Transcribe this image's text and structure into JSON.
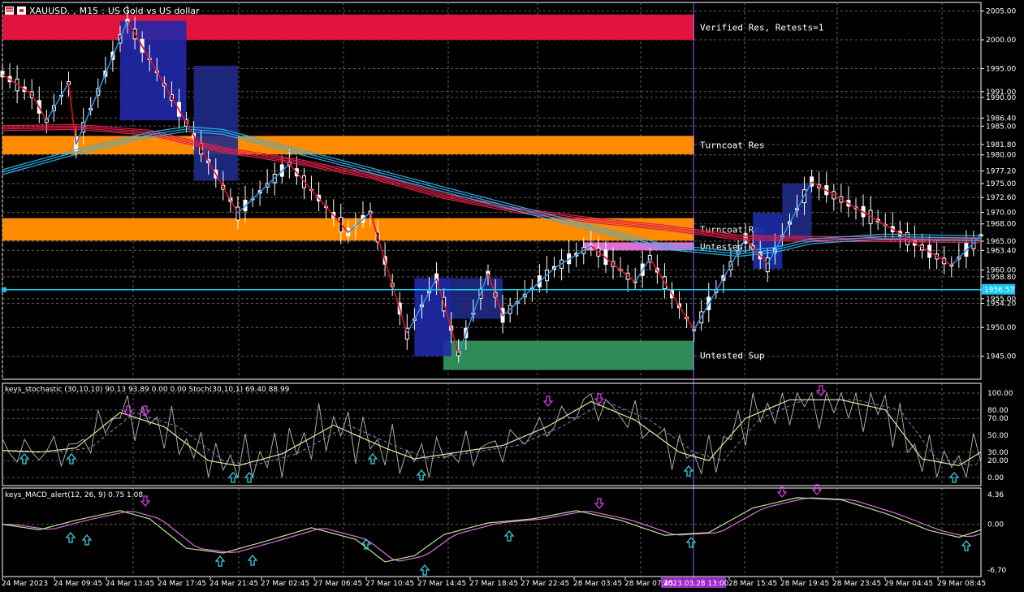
{
  "window": {
    "symbol": "XAUUSD.",
    "timeframe": "M15",
    "description": "US Gold vs US dollar"
  },
  "colors": {
    "bg": "#000000",
    "bull": "#ffffff",
    "bear": "#ffffff",
    "zigzag_up": "#2f8fe0",
    "zigzag_down": "#e01020",
    "verified_res": "#e0143c",
    "turncoat": "#ff8c00",
    "untested_sup": "#2e8b57",
    "untested_res": "#e070d0",
    "hline": "#19c8f0",
    "ma_red": "#e0204a",
    "ma_blue": "#2fb0e8",
    "grid": "#606060",
    "stoch_k": "#a8a8a8",
    "stoch_d": "#b070c0",
    "stoch_sig": "#d0f0a0",
    "macd": "#b8e890",
    "macd_sig": "#e070e0",
    "arrow_up": "#3ad0e0",
    "arrow_down": "#d040e0",
    "cursor": "#9966ff"
  },
  "main": {
    "price_axis": [
      "2005.00",
      "2000.00",
      "1995.00",
      "1991.00",
      "1990.00",
      "1986.40",
      "1985.00",
      "1981.80",
      "1980.00",
      "1977.20",
      "1975.00",
      "1972.60",
      "1970.00",
      "1968.00",
      "1965.00",
      "1963.40",
      "1960.00",
      "1958.80",
      "1956.57",
      "1955.00",
      "1954.20",
      "1950.00",
      "1945.00"
    ],
    "current_price": "1956.57",
    "zones": [
      {
        "label": "Verified Res, Retests=1",
        "kind": "verified_res",
        "low": 2000.0,
        "high": 2004.4
      },
      {
        "label": "Turncoat Res",
        "kind": "turncoat",
        "low": 1980.1,
        "high": 1983.3
      },
      {
        "label": "Turncoat Res",
        "kind": "turncoat",
        "low": 1965.1,
        "high": 1969.0
      },
      {
        "label": "Untested Res",
        "kind": "untested_res",
        "low": 1963.4,
        "high": 1964.8
      },
      {
        "label": "Untested Sup",
        "kind": "untested_sup",
        "low": 1942.6,
        "high": 1947.7
      }
    ]
  },
  "stoch": {
    "title": "keys_stochastic (30,10,10) 90.13 93.89 0.00 0.00 Stoch(30,10,1) 69.40 88.99",
    "axis": [
      "100.00",
      "80.00",
      "70.00",
      "50.00",
      "30.00",
      "20.00",
      "0.00"
    ]
  },
  "macd": {
    "title": "keys_MACD_alert(12, 26, 9) 0.75 1.08",
    "axis": [
      "4.36",
      "0.00",
      "-6.70"
    ]
  },
  "time_axis": [
    "24 Mar 2023",
    "24 Mar 09:45",
    "24 Mar 13:45",
    "24 Mar 17:45",
    "24 Mar 21:45",
    "27 Mar 02:45",
    "27 Mar 06:45",
    "27 Mar 10:45",
    "27 Mar 14:45",
    "27 Mar 18:45",
    "27 Mar 22:45",
    "28 Mar 03:45",
    "28 Mar 07:45",
    "28 Mar 15:45",
    "28 Mar 19:45",
    "28 Mar 23:45",
    "29 Mar 04:45",
    "29 Mar 08:45"
  ],
  "cursor_time": "2023.03.28 13:00",
  "chart_data": {
    "type": "line",
    "title": "XAUUSD., M15: US Gold vs US dollar",
    "y_range": [
      1941.0,
      2006.5
    ],
    "zigzag": [
      [
        0,
        1994.0
      ],
      [
        4,
        1990.5
      ],
      [
        6,
        1986.0
      ],
      [
        9,
        1992.5
      ],
      [
        10,
        1981.8
      ],
      [
        17,
        2003.3
      ],
      [
        25,
        1985.6
      ],
      [
        32,
        1969.9
      ],
      [
        39,
        1978.4
      ],
      [
        47,
        1966.5
      ],
      [
        50,
        1970.0
      ],
      [
        55,
        1949.0
      ],
      [
        59,
        1958.5
      ],
      [
        62,
        1945.5
      ],
      [
        66,
        1959.4
      ],
      [
        68,
        1952.0
      ],
      [
        75,
        1960.3
      ],
      [
        80,
        1964.2
      ],
      [
        86,
        1957.9
      ],
      [
        88,
        1962.0
      ],
      [
        94,
        1949.6
      ],
      [
        99,
        1960.8
      ],
      [
        101,
        1965.4
      ],
      [
        104,
        1961.0
      ],
      [
        110,
        1975.3
      ],
      [
        122,
        1966.3
      ],
      [
        129,
        1960.8
      ],
      [
        133,
        1966.0
      ]
    ],
    "key_candles": [
      [
        0,
        1992.0,
        1994.5,
        1990.0,
        1991.5
      ],
      [
        10,
        1986.0,
        1987.0,
        1981.8,
        1982.5
      ],
      [
        17,
        1999.0,
        2003.3,
        1998.0,
        2002.0
      ],
      [
        25,
        1986.0,
        1987.5,
        1983.5,
        1985.6
      ],
      [
        32,
        1971.0,
        1972.0,
        1969.9,
        1970.5
      ],
      [
        55,
        1950.5,
        1952.0,
        1949.0,
        1950.0
      ],
      [
        62,
        1946.0,
        1949.0,
        1945.5,
        1948.0
      ],
      [
        94,
        1950.0,
        1951.0,
        1949.6,
        1950.5
      ],
      [
        110,
        1974.0,
        1975.3,
        1972.5,
        1975.0
      ],
      [
        129,
        1961.5,
        1962.0,
        1960.8,
        1961.0
      ],
      [
        133,
        1964.5,
        1966.0,
        1963.5,
        1965.5
      ]
    ],
    "ma_red": [
      [
        0,
        1984.8
      ],
      [
        10,
        1985.0
      ],
      [
        20,
        1984.0
      ],
      [
        30,
        1981.0
      ],
      [
        40,
        1979.0
      ],
      [
        50,
        1976.5
      ],
      [
        60,
        1973.0
      ],
      [
        70,
        1970.5
      ],
      [
        80,
        1968.8
      ],
      [
        90,
        1967.5
      ],
      [
        100,
        1965.8
      ],
      [
        110,
        1965.5
      ],
      [
        120,
        1965.5
      ],
      [
        133,
        1965.3
      ]
    ],
    "ma_blue": [
      [
        0,
        1977.0
      ],
      [
        10,
        1980.5
      ],
      [
        20,
        1983.5
      ],
      [
        25,
        1984.5
      ],
      [
        30,
        1984.0
      ],
      [
        90,
        1964.0
      ],
      [
        100,
        1962.8
      ],
      [
        105,
        1963.5
      ],
      [
        110,
        1965.0
      ],
      [
        120,
        1965.8
      ],
      [
        133,
        1965.5
      ]
    ],
    "stochastic": {
      "k_last": 90.13,
      "d_last": 93.89,
      "stoch_main": 69.4,
      "stoch_signal": 88.99,
      "signal": [
        [
          0,
          32
        ],
        [
          5,
          30
        ],
        [
          10,
          35
        ],
        [
          16,
          77
        ],
        [
          22,
          60
        ],
        [
          28,
          20
        ],
        [
          32,
          14
        ],
        [
          38,
          28
        ],
        [
          45,
          62
        ],
        [
          52,
          35
        ],
        [
          56,
          22
        ],
        [
          62,
          30
        ],
        [
          68,
          38
        ],
        [
          74,
          60
        ],
        [
          80,
          90
        ],
        [
          86,
          68
        ],
        [
          92,
          30
        ],
        [
          96,
          20
        ],
        [
          101,
          70
        ],
        [
          107,
          92
        ],
        [
          114,
          92
        ],
        [
          120,
          80
        ],
        [
          125,
          22
        ],
        [
          130,
          14
        ],
        [
          133,
          30
        ]
      ]
    },
    "macd": {
      "main": 0.75,
      "signal": 1.08,
      "y_range": [
        -6.7,
        4.36
      ],
      "line": [
        [
          0,
          0.0
        ],
        [
          5,
          -0.8
        ],
        [
          10,
          0.6
        ],
        [
          16,
          2.0
        ],
        [
          20,
          0.8
        ],
        [
          25,
          -3.5
        ],
        [
          30,
          -4.2
        ],
        [
          36,
          -2.4
        ],
        [
          42,
          -0.5
        ],
        [
          48,
          -2.2
        ],
        [
          52,
          -5.5
        ],
        [
          56,
          -4.6
        ],
        [
          60,
          -1.5
        ],
        [
          66,
          0.2
        ],
        [
          72,
          0.8
        ],
        [
          78,
          2.0
        ],
        [
          84,
          0.6
        ],
        [
          90,
          -1.6
        ],
        [
          96,
          -1.2
        ],
        [
          102,
          2.4
        ],
        [
          108,
          3.9
        ],
        [
          114,
          3.6
        ],
        [
          120,
          1.6
        ],
        [
          126,
          -0.9
        ],
        [
          130,
          -1.9
        ],
        [
          133,
          -0.8
        ]
      ]
    }
  }
}
